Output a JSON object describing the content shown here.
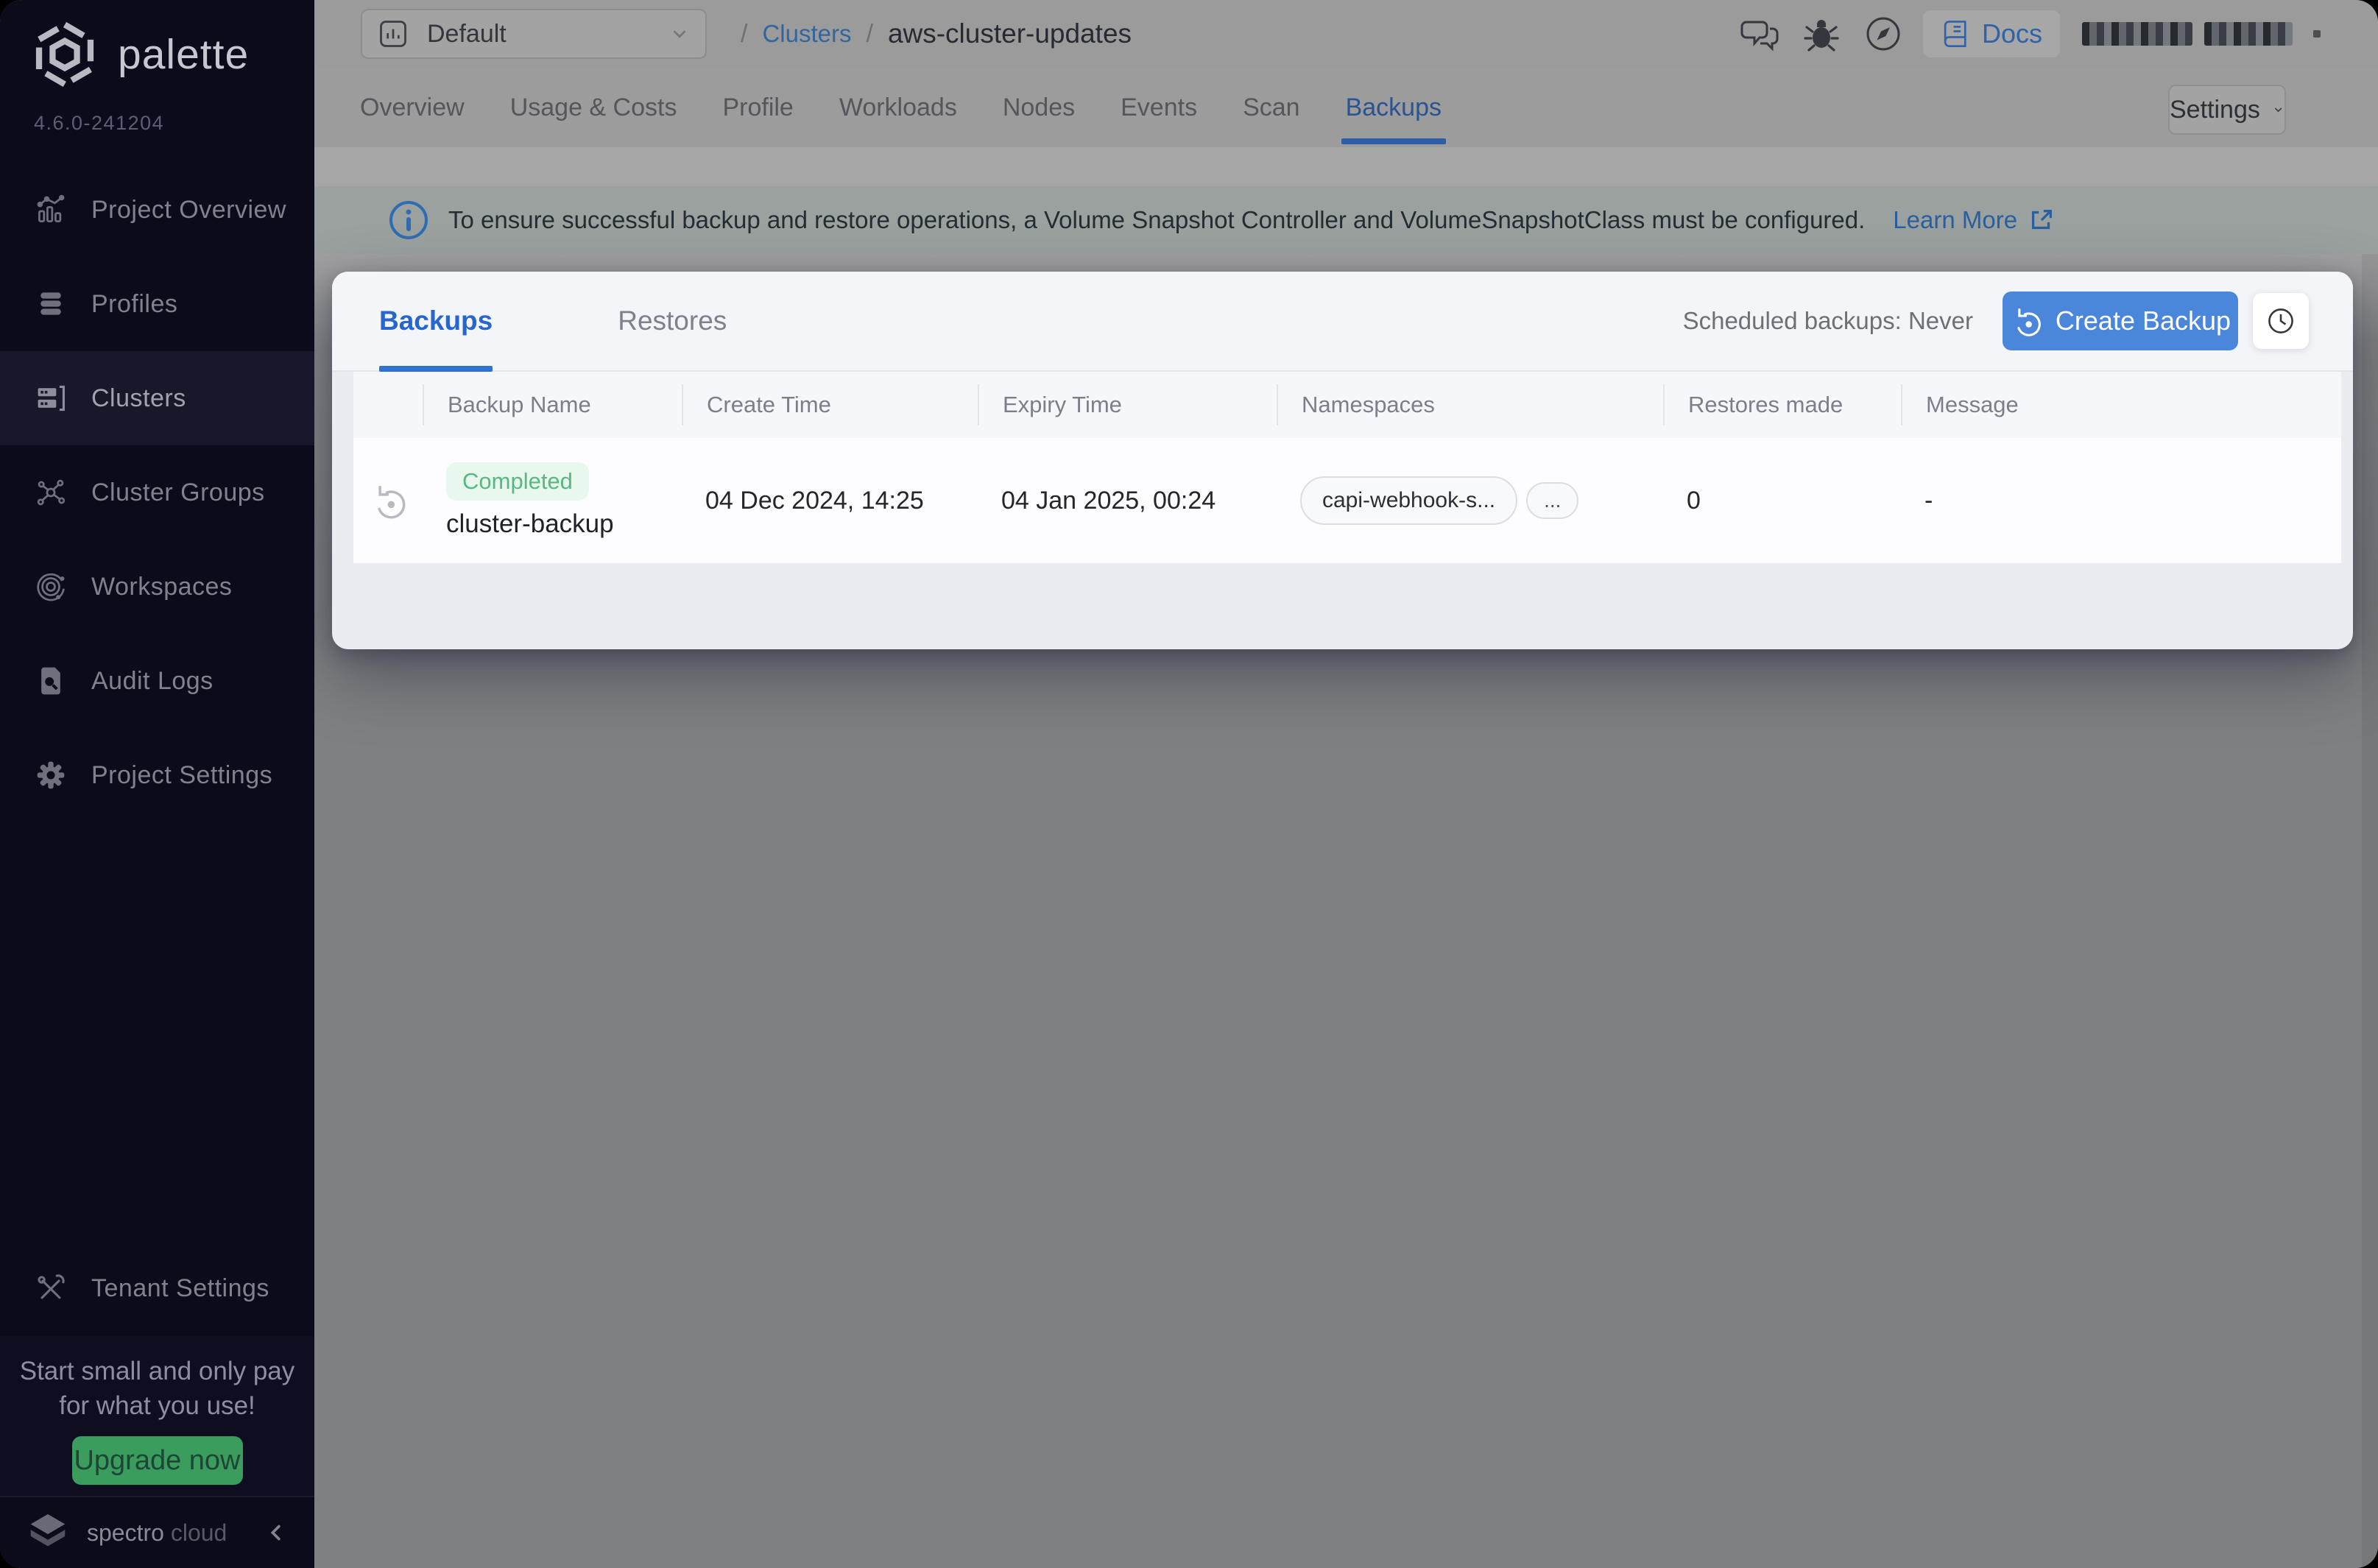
{
  "brand": {
    "name": "palette",
    "version": "4.6.0-241204"
  },
  "sidebar": {
    "items": [
      {
        "label": "Project Overview",
        "icon": "bar-chart-icon"
      },
      {
        "label": "Profiles",
        "icon": "layers-icon"
      },
      {
        "label": "Clusters",
        "icon": "servers-icon"
      },
      {
        "label": "Cluster Groups",
        "icon": "nodes-icon"
      },
      {
        "label": "Workspaces",
        "icon": "orbit-icon"
      },
      {
        "label": "Audit Logs",
        "icon": "doc-search-icon"
      },
      {
        "label": "Project Settings",
        "icon": "gear-icon"
      }
    ],
    "tenant": {
      "label": "Tenant Settings"
    },
    "promo": {
      "line1": "Start small and only pay",
      "line2": "for what you use!",
      "cta": "Upgrade now"
    },
    "footer": {
      "brand1": "spectro",
      "brand2": "cloud"
    }
  },
  "topbar": {
    "project": {
      "value": "Default"
    },
    "breadcrumb": {
      "sep": "/",
      "link": "Clusters",
      "current": "aws-cluster-updates"
    },
    "docs": "Docs"
  },
  "nav_tabs": {
    "items": [
      "Overview",
      "Usage & Costs",
      "Profile",
      "Workloads",
      "Nodes",
      "Events",
      "Scan",
      "Backups"
    ],
    "active": "Backups"
  },
  "settings": {
    "label": "Settings"
  },
  "banner": {
    "message": "To ensure successful backup and restore operations, a Volume Snapshot Controller and VolumeSnapshotClass must be configured.",
    "link": "Learn More"
  },
  "panel": {
    "tabs": {
      "backups": "Backups",
      "restores": "Restores"
    },
    "scheduled": "Scheduled backups: Never",
    "create": "Create Backup",
    "table": {
      "columns": [
        "Backup Name",
        "Create Time",
        "Expiry Time",
        "Namespaces",
        "Restores made",
        "Message"
      ],
      "row": {
        "status": "Completed",
        "name": "cluster-backup",
        "created": "04 Dec 2024, 14:25",
        "expires": "04 Jan 2025, 00:24",
        "namespace": "capi-webhook-s...",
        "more": "...",
        "restores": "0",
        "message": "-"
      }
    }
  },
  "colors": {
    "accent_blue": "#2a6bd4",
    "button_blue": "#4a86d9",
    "success_green": "#57b981",
    "upgrade_green": "#3a9c5d",
    "sidebar_bg": "#0c0b1c"
  }
}
